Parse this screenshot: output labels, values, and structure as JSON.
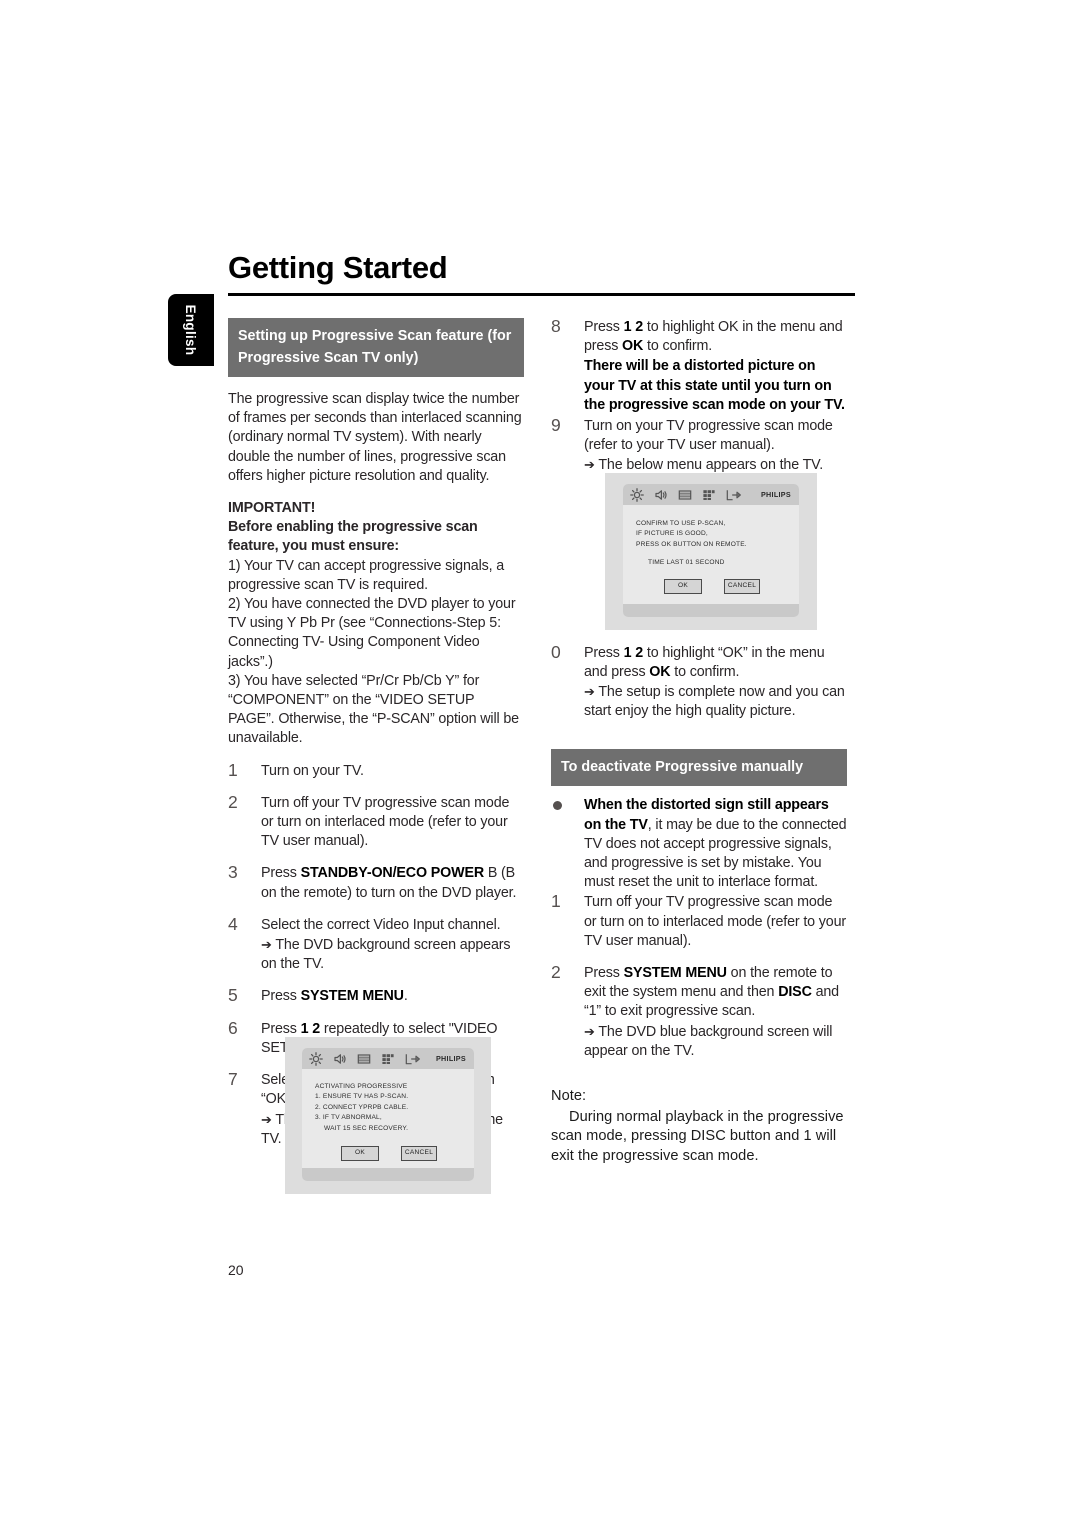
{
  "page": {
    "title": "Getting Started",
    "language_tab": "English",
    "page_number": "20"
  },
  "left_column": {
    "section_heading": "Setting up Progressive Scan feature (for Progressive Scan TV only)",
    "intro_paragraph": "The progressive scan display twice the number of frames per seconds than interlaced scanning (ordinary normal TV system). With nearly double the number of lines, progressive scan offers higher picture resolution and quality.",
    "important_title": "IMPORTANT!",
    "important_subtitle": "Before enabling the progressive scan feature, you must ensure:",
    "important_items": [
      "1) Your TV can accept progressive signals, a progressive scan TV is required.",
      "2) You have connected the DVD player to your TV using Y Pb Pr (see “Connections-Step 5: Connecting TV- Using Component Video jacks”.)",
      "3) You have selected “Pr/Cr Pb/Cb Y” for “COMPONENT” on the “VIDEO SETUP PAGE”. Otherwise, the “P-SCAN” option will be unavailable."
    ],
    "steps": [
      {
        "num": "1",
        "text": "Turn on your TV."
      },
      {
        "num": "2",
        "text": "Turn off your TV progressive scan mode or turn on interlaced mode (refer to your TV user manual)."
      },
      {
        "num": "3",
        "pre": "Press ",
        "bold": "STANDBY-ON/ECO POWER",
        "post": " B  (B on the remote) to turn on the DVD player."
      },
      {
        "num": "4",
        "text": "Select the correct Video Input channel.",
        "arrow": "The DVD background screen appears on the TV."
      },
      {
        "num": "5",
        "pre": "Press ",
        "bold": "SYSTEM MENU",
        "post": "."
      },
      {
        "num": "6",
        "pre": "Press ",
        "bold": "1 2",
        "post": "   repeatedly to select \"VIDEO SETUP PAGE\"."
      },
      {
        "num": "7",
        "text": "Select \"TV MODE\" to \"P-SCAN\", then “OK” to confirm.",
        "arrow": "The instruction menu appears on the TV."
      }
    ]
  },
  "right_column": {
    "steps": [
      {
        "num": "8",
        "pre": "Press ",
        "bold": "1 2",
        "post": "   to highlight OK in the menu and press ",
        "bold2": "OK",
        "post2": " to confirm.",
        "warning": "There will be a distorted picture on your TV at this state until you turn on the progressive scan mode on your TV."
      },
      {
        "num": "9",
        "text": "Turn on your TV progressive scan mode (refer to your TV user manual).",
        "arrow": "The below menu appears on the TV."
      },
      {
        "num": "0",
        "pre": "Press ",
        "bold": "1 2",
        "post": "   to highlight “OK” in the menu and press ",
        "bold2": "OK",
        "post2": " to confirm.",
        "arrow": "The setup is complete now and you can start enjoy the high quality picture."
      }
    ],
    "section_heading": "To deactivate Progressive manually",
    "bullet": {
      "bold": "When the distorted sign still appears on the TV",
      "rest": ", it may be due to the connected TV does not accept progressive signals, and progressive is set by mistake. You must reset the unit to interlace format."
    },
    "deactivate_steps": [
      {
        "num": "1",
        "text": "Turn off your TV progressive scan mode or turn on to interlaced mode (refer to your TV user manual)."
      },
      {
        "num": "2",
        "pre": "Press ",
        "bold": "SYSTEM MENU",
        "post": " on the remote to exit the system menu and then ",
        "bold2": "DISC",
        "post2": " and “1” to exit progressive scan.",
        "arrow": "The DVD blue background screen will appear on the TV."
      }
    ],
    "note": {
      "label": "Note:",
      "body": "During normal playback in the progressive scan mode, pressing DISC button and  1  will exit the progressive scan mode."
    }
  },
  "tv_screen_1": {
    "brand": "PHILIPS",
    "icons": [
      "gear-icon",
      "speaker-icon",
      "video-screen-icon",
      "grid-preferences-icon",
      "exit-arrow-icon"
    ],
    "lines": [
      "ACTIVATING PROGRESSIVE",
      "1. ENSURE TV HAS P-SCAN.",
      "2. CONNECT YPRPB CABLE.",
      "3. IF TV ABNORMAL,",
      "WAIT 15 SEC RECOVERY."
    ],
    "ok_label": "OK",
    "cancel_label": "CANCEL"
  },
  "tv_screen_2": {
    "brand": "PHILIPS",
    "icons": [
      "gear-icon",
      "speaker-icon",
      "video-screen-icon",
      "grid-preferences-icon",
      "exit-arrow-icon"
    ],
    "lines": [
      "CONFIRM TO USE P-SCAN,",
      "IF PICTURE IS GOOD,",
      "PRESS OK BUTTON ON REMOTE."
    ],
    "timer_line": "TIME LAST 01 SECOND",
    "ok_label": "OK",
    "cancel_label": "CANCEL"
  },
  "colors": {
    "section_bar": "#6f6f6f",
    "tab_background": "#000000",
    "tv_chrome": "#c9c9c9",
    "tv_panel": "#e9e9e9"
  }
}
